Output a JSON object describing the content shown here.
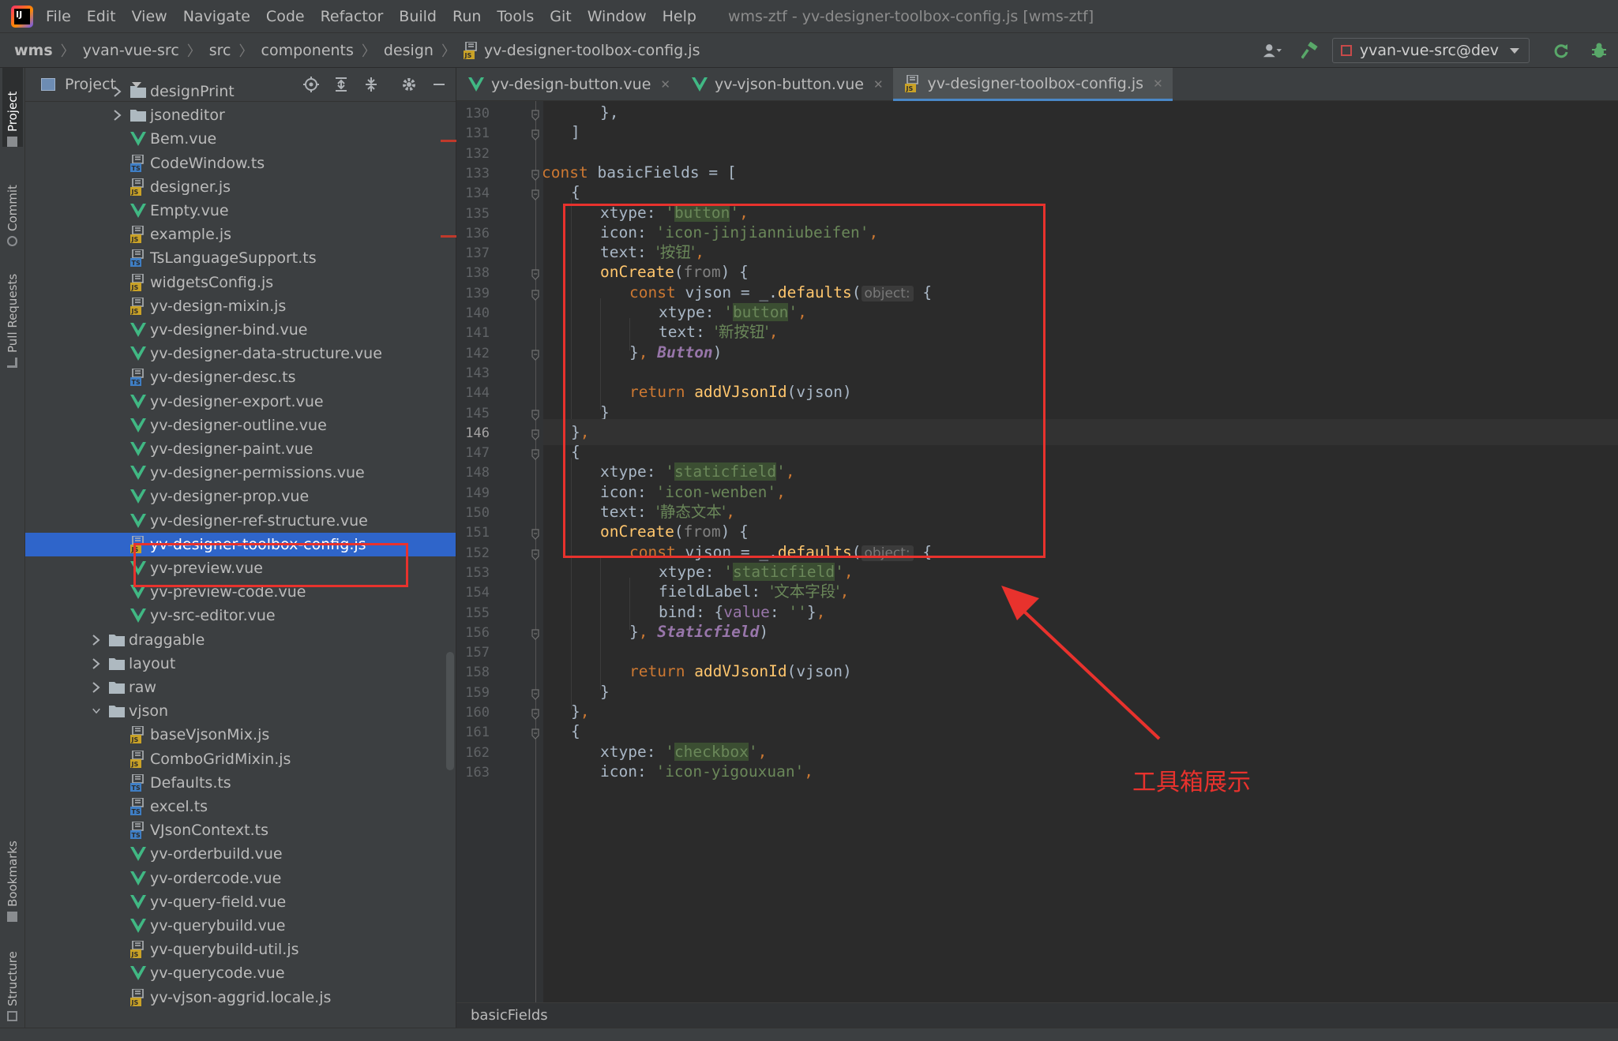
{
  "menubar": {
    "items": [
      "File",
      "Edit",
      "View",
      "Navigate",
      "Code",
      "Refactor",
      "Build",
      "Run",
      "Tools",
      "Git",
      "Window",
      "Help"
    ],
    "window_title": "wms-ztf - yv-designer-toolbox-config.js [wms-ztf]"
  },
  "navbar": {
    "breadcrumbs": [
      "wms",
      "yvan-vue-src",
      "src",
      "components",
      "design",
      "yv-designer-toolbox-config.js"
    ],
    "vcs_branch": "yvan-vue-src@dev"
  },
  "left_strip": {
    "project": "Project",
    "commit": "Commit",
    "pull_requests": "Pull Requests",
    "bookmarks": "Bookmarks",
    "structure": "Structure"
  },
  "project_panel": {
    "title": "Project",
    "tree": [
      {
        "label": "designPrint",
        "type": "folder",
        "level": 1,
        "expanded": false
      },
      {
        "label": "jsoneditor",
        "type": "folder",
        "level": 1,
        "expanded": false
      },
      {
        "label": "Bem.vue",
        "type": "vue",
        "level": 1
      },
      {
        "label": "CodeWindow.ts",
        "type": "ts",
        "level": 1
      },
      {
        "label": "designer.js",
        "type": "js",
        "level": 1
      },
      {
        "label": "Empty.vue",
        "type": "vue",
        "level": 1
      },
      {
        "label": "example.js",
        "type": "js",
        "level": 1
      },
      {
        "label": "TsLanguageSupport.ts",
        "type": "ts",
        "level": 1
      },
      {
        "label": "widgetsConfig.js",
        "type": "js",
        "level": 1
      },
      {
        "label": "yv-design-mixin.js",
        "type": "js",
        "level": 1
      },
      {
        "label": "yv-designer-bind.vue",
        "type": "vue",
        "level": 1
      },
      {
        "label": "yv-designer-data-structure.vue",
        "type": "vue",
        "level": 1
      },
      {
        "label": "yv-designer-desc.ts",
        "type": "ts",
        "level": 1
      },
      {
        "label": "yv-designer-export.vue",
        "type": "vue",
        "level": 1
      },
      {
        "label": "yv-designer-outline.vue",
        "type": "vue",
        "level": 1
      },
      {
        "label": "yv-designer-paint.vue",
        "type": "vue",
        "level": 1
      },
      {
        "label": "yv-designer-permissions.vue",
        "type": "vue",
        "level": 1
      },
      {
        "label": "yv-designer-prop.vue",
        "type": "vue",
        "level": 1
      },
      {
        "label": "yv-designer-ref-structure.vue",
        "type": "vue",
        "level": 1
      },
      {
        "label": "yv-designer-toolbox-config.js",
        "type": "js",
        "level": 1,
        "selected": true
      },
      {
        "label": "yv-preview.vue",
        "type": "vue",
        "level": 1
      },
      {
        "label": "yv-preview-code.vue",
        "type": "vue",
        "level": 1
      },
      {
        "label": "yv-src-editor.vue",
        "type": "vue",
        "level": 1
      },
      {
        "label": "draggable",
        "type": "folder",
        "level": 0,
        "expanded": false
      },
      {
        "label": "layout",
        "type": "folder",
        "level": 0,
        "expanded": false
      },
      {
        "label": "raw",
        "type": "folder",
        "level": 0,
        "expanded": false
      },
      {
        "label": "vjson",
        "type": "folder",
        "level": 0,
        "expanded": true
      },
      {
        "label": "baseVjsonMix.js",
        "type": "js",
        "level": 1
      },
      {
        "label": "ComboGridMixin.js",
        "type": "js",
        "level": 1
      },
      {
        "label": "Defaults.ts",
        "type": "ts",
        "level": 1
      },
      {
        "label": "excel.ts",
        "type": "ts",
        "level": 1
      },
      {
        "label": "VJsonContext.ts",
        "type": "ts",
        "level": 1
      },
      {
        "label": "yv-orderbuild.vue",
        "type": "vue",
        "level": 1
      },
      {
        "label": "yv-ordercode.vue",
        "type": "vue",
        "level": 1
      },
      {
        "label": "yv-query-field.vue",
        "type": "vue",
        "level": 1
      },
      {
        "label": "yv-querybuild.vue",
        "type": "vue",
        "level": 1
      },
      {
        "label": "yv-querybuild-util.js",
        "type": "js",
        "level": 1
      },
      {
        "label": "yv-querycode.vue",
        "type": "vue",
        "level": 1
      },
      {
        "label": "yv-vjson-aggrid.locale.js",
        "type": "js",
        "level": 1
      }
    ]
  },
  "editor": {
    "tabs": [
      {
        "label": "yv-design-button.vue",
        "type": "vue",
        "active": false
      },
      {
        "label": "yv-vjson-button.vue",
        "type": "vue",
        "active": false
      },
      {
        "label": "yv-designer-toolbox-config.js",
        "type": "js",
        "active": true
      }
    ],
    "first_line": 130,
    "current_line": 146,
    "lines": [
      {
        "indent": 2,
        "t": [
          [
            "p",
            "},"
          ]
        ]
      },
      {
        "indent": 1,
        "t": [
          [
            "p",
            "]"
          ]
        ]
      },
      {
        "indent": 0,
        "t": []
      },
      {
        "indent": 0,
        "t": [
          [
            "kw",
            "const "
          ],
          [
            "p",
            "basicFields = ["
          ]
        ]
      },
      {
        "indent": 1,
        "t": [
          [
            "p",
            "{"
          ]
        ]
      },
      {
        "indent": 2,
        "t": [
          [
            "p",
            "xtype: "
          ],
          [
            "str",
            "'"
          ],
          [
            "hl",
            "button"
          ],
          [
            "str",
            "'"
          ],
          [
            "kw",
            ","
          ]
        ]
      },
      {
        "indent": 2,
        "t": [
          [
            "p",
            "icon: "
          ],
          [
            "str",
            "'icon-jinjianniubeifen'"
          ],
          [
            "kw",
            ","
          ]
        ]
      },
      {
        "indent": 2,
        "t": [
          [
            "p",
            "text: "
          ],
          [
            "cjk",
            "'按钮'"
          ],
          [
            "kw",
            ","
          ]
        ]
      },
      {
        "indent": 2,
        "t": [
          [
            "fn",
            "onCreate"
          ],
          [
            "p",
            "("
          ],
          [
            "param",
            "from"
          ],
          [
            "p",
            ") {"
          ]
        ]
      },
      {
        "indent": 3,
        "t": [
          [
            "kw",
            "const "
          ],
          [
            "p",
            "vjson = _."
          ],
          [
            "fn",
            "defaults"
          ],
          [
            "p",
            "("
          ],
          [
            "hint",
            "object:"
          ],
          [
            "p",
            " {"
          ]
        ]
      },
      {
        "indent": 4,
        "t": [
          [
            "p",
            "xtype: "
          ],
          [
            "str",
            "'"
          ],
          [
            "hl",
            "button"
          ],
          [
            "str",
            "'"
          ],
          [
            "kw",
            ","
          ]
        ]
      },
      {
        "indent": 4,
        "t": [
          [
            "p",
            "text: "
          ],
          [
            "cjk",
            "'新按钮'"
          ],
          [
            "kw",
            ","
          ]
        ]
      },
      {
        "indent": 3,
        "t": [
          [
            "p",
            "}"
          ],
          [
            "kw",
            ", "
          ],
          [
            "cls",
            "Button"
          ],
          [
            "p",
            ")"
          ]
        ]
      },
      {
        "indent": 0,
        "t": []
      },
      {
        "indent": 3,
        "t": [
          [
            "kw",
            "return "
          ],
          [
            "fn",
            "addVJsonId"
          ],
          [
            "p",
            "(vjson)"
          ]
        ]
      },
      {
        "indent": 2,
        "t": [
          [
            "p",
            "}"
          ]
        ]
      },
      {
        "indent": 1,
        "t": [
          [
            "p",
            "}"
          ],
          [
            "kw",
            ","
          ]
        ]
      },
      {
        "indent": 1,
        "t": [
          [
            "p",
            "{"
          ]
        ]
      },
      {
        "indent": 2,
        "t": [
          [
            "p",
            "xtype: "
          ],
          [
            "str",
            "'"
          ],
          [
            "hl",
            "staticfield"
          ],
          [
            "str",
            "'"
          ],
          [
            "kw",
            ","
          ]
        ]
      },
      {
        "indent": 2,
        "t": [
          [
            "p",
            "icon: "
          ],
          [
            "str",
            "'icon-wenben'"
          ],
          [
            "kw",
            ","
          ]
        ]
      },
      {
        "indent": 2,
        "t": [
          [
            "p",
            "text: "
          ],
          [
            "cjk",
            "'静态文本'"
          ],
          [
            "kw",
            ","
          ]
        ]
      },
      {
        "indent": 2,
        "t": [
          [
            "fn",
            "onCreate"
          ],
          [
            "p",
            "("
          ],
          [
            "param",
            "from"
          ],
          [
            "p",
            ") {"
          ]
        ]
      },
      {
        "indent": 3,
        "t": [
          [
            "kw",
            "const "
          ],
          [
            "p",
            "vjson = _."
          ],
          [
            "fn",
            "defaults"
          ],
          [
            "p",
            "("
          ],
          [
            "hint",
            "object:"
          ],
          [
            "p",
            " {"
          ]
        ]
      },
      {
        "indent": 4,
        "t": [
          [
            "p",
            "xtype: "
          ],
          [
            "str",
            "'"
          ],
          [
            "hl",
            "staticfield"
          ],
          [
            "str",
            "'"
          ],
          [
            "kw",
            ","
          ]
        ]
      },
      {
        "indent": 4,
        "t": [
          [
            "p",
            "fieldLabel: "
          ],
          [
            "cjk",
            "'文本字段'"
          ],
          [
            "kw",
            ","
          ]
        ]
      },
      {
        "indent": 4,
        "t": [
          [
            "p",
            "bind: {"
          ],
          [
            "prop",
            "value"
          ],
          [
            "p",
            ": "
          ],
          [
            "str",
            "''"
          ],
          [
            "p",
            "}"
          ],
          [
            "kw",
            ","
          ]
        ]
      },
      {
        "indent": 3,
        "t": [
          [
            "p",
            "}"
          ],
          [
            "kw",
            ", "
          ],
          [
            "cls",
            "Staticfield"
          ],
          [
            "p",
            ")"
          ]
        ]
      },
      {
        "indent": 0,
        "t": []
      },
      {
        "indent": 3,
        "t": [
          [
            "kw",
            "return "
          ],
          [
            "fn",
            "addVJsonId"
          ],
          [
            "p",
            "(vjson)"
          ]
        ]
      },
      {
        "indent": 2,
        "t": [
          [
            "p",
            "}"
          ]
        ]
      },
      {
        "indent": 1,
        "t": [
          [
            "p",
            "}"
          ],
          [
            "kw",
            ","
          ]
        ]
      },
      {
        "indent": 1,
        "t": [
          [
            "p",
            "{"
          ]
        ]
      },
      {
        "indent": 2,
        "t": [
          [
            "p",
            "xtype: "
          ],
          [
            "str",
            "'"
          ],
          [
            "hl",
            "checkbox"
          ],
          [
            "str",
            "'"
          ],
          [
            "kw",
            ","
          ]
        ]
      },
      {
        "indent": 2,
        "t": [
          [
            "p",
            "icon: "
          ],
          [
            "str",
            "'icon-yigouxuan'"
          ],
          [
            "kw",
            ","
          ]
        ]
      }
    ],
    "breadcrumb": "basicFields"
  },
  "annotation": {
    "label": "工具箱展示",
    "color": "#e8322d"
  },
  "colors": {
    "accent": "#2f65ca",
    "keyword": "#cc7832",
    "function": "#ffc66d",
    "string": "#6a8759"
  }
}
